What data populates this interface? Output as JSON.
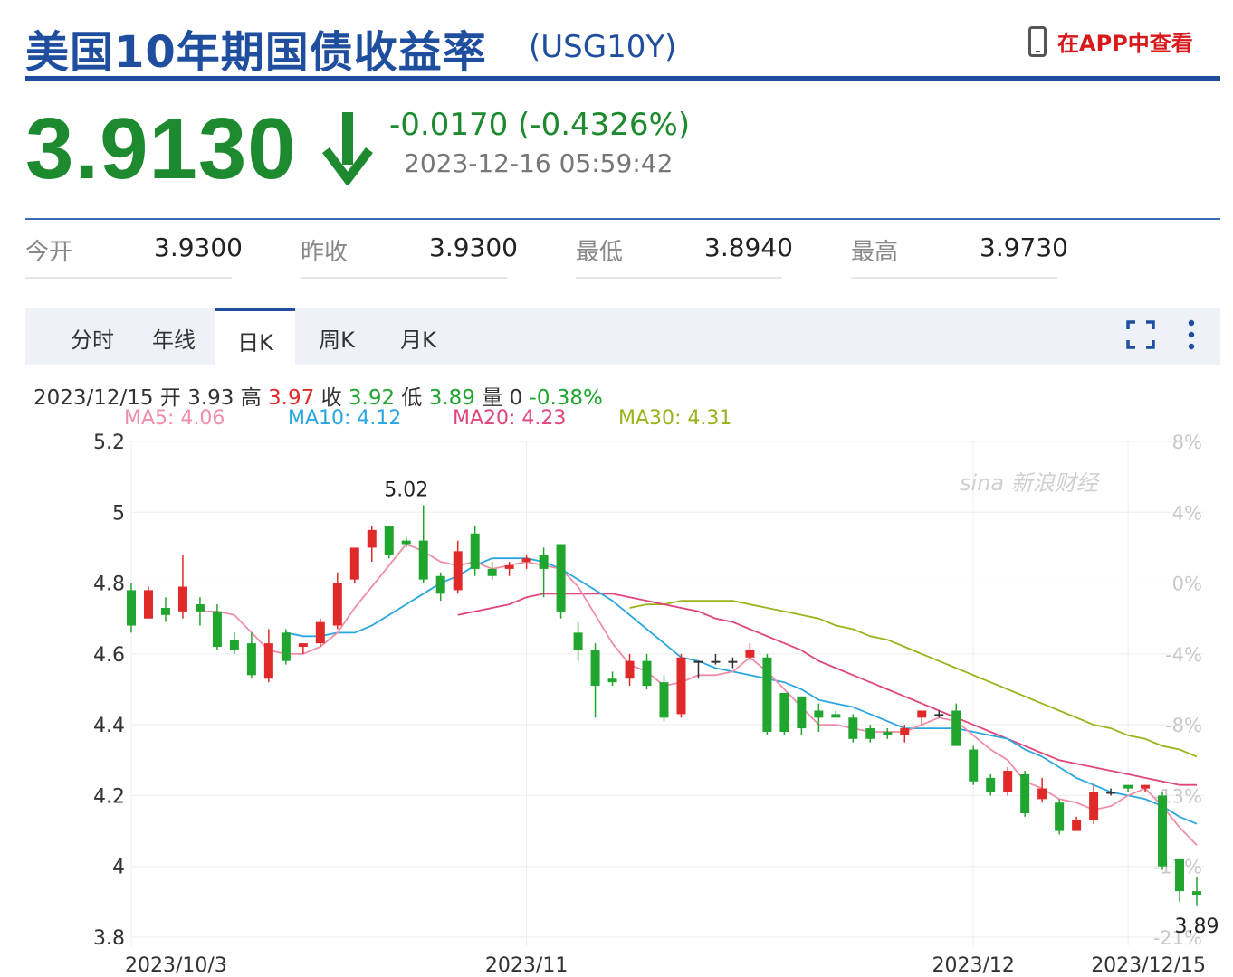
{
  "header": {
    "title": "美国10年期国债收益率",
    "code": "(USG10Y)",
    "app_link": "在APP中查看"
  },
  "quote": {
    "price": "3.9130",
    "change": "-0.0170 (-0.4326%)",
    "timestamp": "2023-12-16 05:59:42",
    "direction": "down"
  },
  "stats": [
    {
      "label": "今开",
      "value": "3.9300"
    },
    {
      "label": "昨收",
      "value": "3.9300"
    },
    {
      "label": "最低",
      "value": "3.8940"
    },
    {
      "label": "最高",
      "value": "3.9730"
    }
  ],
  "tabs": [
    {
      "label": "分时",
      "active": false
    },
    {
      "label": "年线",
      "active": false
    },
    {
      "label": "日K",
      "active": true
    },
    {
      "label": "周K",
      "active": false
    },
    {
      "label": "月K",
      "active": false
    }
  ],
  "info": {
    "date": "2023/12/15",
    "open_label": "开",
    "open": "3.93",
    "high_label": "高",
    "high": "3.97",
    "close_label": "收",
    "close": "3.92",
    "low_label": "低",
    "low": "3.89",
    "vol_label": "量",
    "vol": "0",
    "change_pct": "-0.38%"
  },
  "ma_legend": [
    {
      "label": "MA5: 4.06",
      "color": "#f08ea8"
    },
    {
      "label": "MA10: 4.12",
      "color": "#2aa6e0"
    },
    {
      "label": "MA20: 4.23",
      "color": "#e0457b"
    },
    {
      "label": "MA30: 4.31",
      "color": "#9bb21a"
    }
  ],
  "colors": {
    "up": "#e02a2a",
    "down": "#20a52f",
    "brand": "#1f4e9f",
    "ma5": "#f08ea8",
    "ma10": "#2aa6e0",
    "ma20": "#e0457b",
    "ma30": "#9bb21a"
  },
  "watermark": "sina 新浪财经",
  "chart_data": {
    "type": "candlestick",
    "ylim": [
      3.8,
      5.2
    ],
    "y_ticks": [
      "5.2",
      "5",
      "4.8",
      "4.6",
      "4.4",
      "4.2",
      "4",
      "3.8"
    ],
    "y_tick_values": [
      5.2,
      5.0,
      4.8,
      4.6,
      4.4,
      4.2,
      4.0,
      3.8
    ],
    "right_ticks": [
      "8%",
      "4%",
      "0%",
      "-4%",
      "-8%",
      "-13%",
      "-17%",
      "-21%"
    ],
    "x_labels": [
      {
        "label": "2023/10/3",
        "index": 0
      },
      {
        "label": "2023/11",
        "index": 23
      },
      {
        "label": "2023/12",
        "index": 49
      },
      {
        "label": "2023/12/15",
        "index": 58
      }
    ],
    "annotations": [
      {
        "text": "5.02",
        "index": 16,
        "value": 5.02
      },
      {
        "text": "3.89",
        "index": 62,
        "value": 3.89
      }
    ],
    "candles": [
      [
        4.78,
        4.68,
        4.8,
        4.66
      ],
      [
        4.7,
        4.78,
        4.79,
        4.7
      ],
      [
        4.73,
        4.71,
        4.76,
        4.69
      ],
      [
        4.72,
        4.79,
        4.88,
        4.7
      ],
      [
        4.74,
        4.72,
        4.76,
        4.68
      ],
      [
        4.72,
        4.62,
        4.74,
        4.61
      ],
      [
        4.64,
        4.61,
        4.66,
        4.6
      ],
      [
        4.63,
        4.54,
        4.66,
        4.53
      ],
      [
        4.53,
        4.63,
        4.67,
        4.52
      ],
      [
        4.66,
        4.58,
        4.67,
        4.57
      ],
      [
        4.62,
        4.63,
        4.63,
        4.6
      ],
      [
        4.63,
        4.69,
        4.7,
        4.62
      ],
      [
        4.68,
        4.8,
        4.83,
        4.67
      ],
      [
        4.81,
        4.9,
        4.9,
        4.8
      ],
      [
        4.9,
        4.95,
        4.96,
        4.86
      ],
      [
        4.96,
        4.88,
        4.96,
        4.87
      ],
      [
        4.92,
        4.91,
        4.93,
        4.9
      ],
      [
        4.92,
        4.81,
        5.02,
        4.8
      ],
      [
        4.82,
        4.77,
        4.83,
        4.75
      ],
      [
        4.78,
        4.89,
        4.92,
        4.77
      ],
      [
        4.94,
        4.84,
        4.96,
        4.82
      ],
      [
        4.84,
        4.82,
        4.86,
        4.81
      ],
      [
        4.84,
        4.85,
        4.86,
        4.82
      ],
      [
        4.86,
        4.87,
        4.88,
        4.84
      ],
      [
        4.88,
        4.84,
        4.9,
        4.76
      ],
      [
        4.91,
        4.72,
        4.91,
        4.7
      ],
      [
        4.66,
        4.61,
        4.69,
        4.58
      ],
      [
        4.61,
        4.51,
        4.63,
        4.42
      ],
      [
        4.53,
        4.52,
        4.55,
        4.51
      ],
      [
        4.53,
        4.58,
        4.6,
        4.51
      ],
      [
        4.58,
        4.51,
        4.6,
        4.5
      ],
      [
        4.52,
        4.42,
        4.54,
        4.41
      ],
      [
        4.43,
        4.59,
        4.6,
        4.42
      ],
      [
        4.58,
        4.58,
        4.58,
        4.53
      ],
      [
        4.58,
        4.58,
        4.6,
        4.57
      ],
      [
        4.58,
        4.58,
        4.59,
        4.56
      ],
      [
        4.59,
        4.61,
        4.63,
        4.58
      ],
      [
        4.59,
        4.38,
        4.6,
        4.37
      ],
      [
        4.49,
        4.38,
        4.49,
        4.37
      ],
      [
        4.48,
        4.39,
        4.48,
        4.37
      ],
      [
        4.44,
        4.42,
        4.46,
        4.38
      ],
      [
        4.43,
        4.42,
        4.44,
        4.42
      ],
      [
        4.42,
        4.36,
        4.43,
        4.35
      ],
      [
        4.39,
        4.36,
        4.4,
        4.35
      ],
      [
        4.38,
        4.37,
        4.39,
        4.36
      ],
      [
        4.37,
        4.39,
        4.4,
        4.35
      ],
      [
        4.42,
        4.44,
        4.44,
        4.4
      ],
      [
        4.43,
        4.43,
        4.44,
        4.42
      ],
      [
        4.44,
        4.34,
        4.46,
        4.34
      ],
      [
        4.33,
        4.24,
        4.34,
        4.23
      ],
      [
        4.25,
        4.21,
        4.26,
        4.2
      ],
      [
        4.21,
        4.27,
        4.28,
        4.2
      ],
      [
        4.26,
        4.15,
        4.27,
        4.14
      ],
      [
        4.19,
        4.22,
        4.25,
        4.18
      ],
      [
        4.18,
        4.1,
        4.19,
        4.09
      ],
      [
        4.1,
        4.13,
        4.14,
        4.1
      ],
      [
        4.13,
        4.21,
        4.23,
        4.12
      ],
      [
        4.21,
        4.21,
        4.22,
        4.2
      ],
      [
        4.23,
        4.22,
        4.23,
        4.21
      ],
      [
        4.22,
        4.23,
        4.23,
        4.21
      ],
      [
        4.2,
        4.0,
        4.21,
        3.99
      ],
      [
        4.02,
        3.93,
        4.02,
        3.9
      ],
      [
        3.93,
        3.92,
        3.97,
        3.89
      ]
    ],
    "series": [
      {
        "name": "MA5",
        "values": [
          null,
          null,
          null,
          null,
          4.72,
          4.72,
          4.71,
          4.66,
          4.61,
          4.6,
          4.6,
          4.62,
          4.66,
          4.73,
          4.79,
          4.85,
          4.91,
          4.89,
          4.86,
          4.85,
          4.86,
          4.84,
          4.85,
          4.86,
          4.85,
          4.84,
          4.79,
          4.71,
          4.63,
          4.57,
          4.55,
          4.51,
          4.52,
          4.54,
          4.54,
          4.55,
          4.59,
          4.55,
          4.5,
          4.45,
          4.4,
          4.4,
          4.39,
          4.38,
          4.38,
          4.38,
          4.4,
          4.42,
          4.41,
          4.37,
          4.33,
          4.3,
          4.24,
          4.22,
          4.19,
          4.18,
          4.16,
          4.17,
          4.2,
          4.22,
          4.17,
          4.11,
          4.06
        ]
      },
      {
        "name": "MA10",
        "values": [
          null,
          null,
          null,
          null,
          null,
          null,
          null,
          null,
          null,
          4.66,
          4.65,
          4.65,
          4.66,
          4.66,
          4.68,
          4.71,
          4.74,
          4.77,
          4.8,
          4.82,
          4.85,
          4.87,
          4.87,
          4.87,
          4.86,
          4.84,
          4.81,
          4.78,
          4.75,
          4.71,
          4.67,
          4.63,
          4.59,
          4.58,
          4.56,
          4.55,
          4.54,
          4.53,
          4.52,
          4.5,
          4.47,
          4.46,
          4.45,
          4.43,
          4.41,
          4.39,
          4.39,
          4.39,
          4.39,
          4.38,
          4.37,
          4.36,
          4.33,
          4.31,
          4.28,
          4.25,
          4.23,
          4.21,
          4.2,
          4.19,
          4.17,
          4.14,
          4.12
        ]
      },
      {
        "name": "MA20",
        "values": [
          null,
          null,
          null,
          null,
          null,
          null,
          null,
          null,
          null,
          null,
          null,
          null,
          null,
          null,
          null,
          null,
          null,
          null,
          null,
          4.71,
          4.72,
          4.73,
          4.74,
          4.76,
          4.77,
          4.77,
          4.77,
          4.77,
          4.77,
          4.76,
          4.75,
          4.74,
          4.73,
          4.72,
          4.7,
          4.69,
          4.67,
          4.65,
          4.63,
          4.61,
          4.58,
          4.56,
          4.54,
          4.52,
          4.5,
          4.48,
          4.46,
          4.44,
          4.42,
          4.4,
          4.38,
          4.36,
          4.34,
          4.32,
          4.3,
          4.29,
          4.28,
          4.27,
          4.26,
          4.25,
          4.24,
          4.23,
          4.23
        ]
      },
      {
        "name": "MA30",
        "values": [
          null,
          null,
          null,
          null,
          null,
          null,
          null,
          null,
          null,
          null,
          null,
          null,
          null,
          null,
          null,
          null,
          null,
          null,
          null,
          null,
          null,
          null,
          null,
          null,
          null,
          null,
          null,
          null,
          null,
          4.73,
          4.74,
          4.74,
          4.75,
          4.75,
          4.75,
          4.75,
          4.74,
          4.73,
          4.72,
          4.71,
          4.7,
          4.68,
          4.67,
          4.65,
          4.64,
          4.62,
          4.6,
          4.58,
          4.56,
          4.54,
          4.52,
          4.5,
          4.48,
          4.46,
          4.44,
          4.42,
          4.4,
          4.39,
          4.37,
          4.36,
          4.34,
          4.33,
          4.31
        ]
      }
    ]
  }
}
